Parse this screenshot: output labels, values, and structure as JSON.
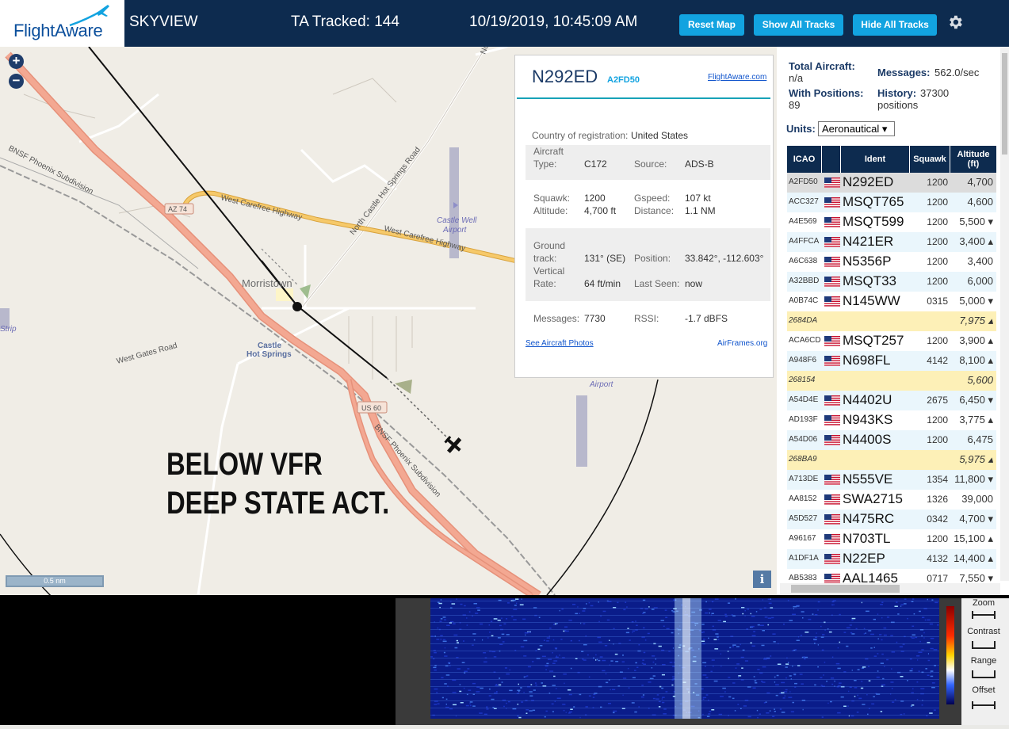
{
  "header": {
    "logo_text": "FlightAware",
    "app_title": "SKYVIEW",
    "tracked": "TA Tracked: 144",
    "datetime": "10/19/2019, 10:45:09 AM",
    "buttons": {
      "reset": "Reset Map",
      "show": "Show All Tracks",
      "hide": "Hide All Tracks"
    },
    "gear_icon": "gear-icon"
  },
  "map": {
    "zoom_in": "+",
    "zoom_out": "−",
    "labels": {
      "bnsf1": "BNSF Phoenix Subdivision",
      "bnsf2": "BNSF Phoenix Subdivision",
      "az74": "AZ 74",
      "wch1": "West Carefree Highway",
      "wch2": "West Carefree Highway",
      "ncsh": "North Castle Hot Springs Road",
      "castle_well": "Castle Well",
      "airport1": "Airport",
      "morristown": "Morristown",
      "castle_hot": "Castle",
      "castle_hot2": "Hot Springs",
      "west_gates": "West Gates Road",
      "us60": "US 60",
      "airport2": "Airport",
      "strip": "Strip",
      "nr": "Nor"
    },
    "scale": "0.5 nm",
    "info_button": "i",
    "overlay_line1": "BELOW VFR",
    "overlay_line2": "DEEP STATE ACT."
  },
  "popup": {
    "registration": "N292ED",
    "icao": "A2FD50",
    "flightaware_link": "FlightAware.com",
    "country_label": "Country of registration:",
    "country": "United States",
    "aircraft_type_label": "Aircraft",
    "aircraft_type_label2": "Type:",
    "aircraft_type": "C172",
    "source_label": "Source:",
    "source": "ADS-B",
    "squawk_label": "Squawk:",
    "squawk": "1200",
    "gspeed_label": "Gspeed:",
    "gspeed": "107 kt",
    "altitude_label": "Altitude:",
    "altitude": "4,700 ft",
    "distance_label": "Distance:",
    "distance": "1.1 NM",
    "ground_label": "Ground",
    "track_label": "track:",
    "track": "131° (SE)",
    "position_label": "Position:",
    "position": "33.842°, -112.603°",
    "vertical_label": "Vertical",
    "rate_label": "Rate:",
    "rate": "64 ft/min",
    "last_seen_label": "Last Seen:",
    "last_seen": "now",
    "messages_label": "Messages:",
    "messages": "7730",
    "rssi_label": "RSSI:",
    "rssi": "-1.7 dBFS",
    "photos_link": "See Aircraft Photos",
    "airframes_link": "AirFrames.org"
  },
  "stats": {
    "total_label": "Total Aircraft:",
    "total": "n/a",
    "messages_label": "Messages:",
    "messages": "562.0/sec",
    "with_pos_label": "With Positions:",
    "with_pos": "89",
    "history_label": "History:",
    "history": "37300",
    "history2": "positions",
    "units_label": "Units:",
    "units": "Aeronautical ▾"
  },
  "table": {
    "headers": [
      "ICAO",
      "",
      "Ident",
      "Squawk",
      "Altitude (ft)"
    ],
    "rows": [
      {
        "icao": "A2FD50",
        "flag": true,
        "ident": "N292ED",
        "squawk": "1200",
        "alt": "4,700",
        "hl": "sel"
      },
      {
        "icao": "ACC327",
        "flag": true,
        "ident": "MSQT765",
        "squawk": "1200",
        "alt": "4,600",
        "hl": ""
      },
      {
        "icao": "A4E569",
        "flag": true,
        "ident": "MSQT599",
        "squawk": "1200",
        "alt": "5,500 ▾",
        "hl": ""
      },
      {
        "icao": "A4FFCA",
        "flag": true,
        "ident": "N421ER",
        "squawk": "1200",
        "alt": "3,400 ▴",
        "hl": ""
      },
      {
        "icao": "A6C638",
        "flag": true,
        "ident": "N5356P",
        "squawk": "1200",
        "alt": "3,400",
        "hl": ""
      },
      {
        "icao": "A32BBD",
        "flag": true,
        "ident": "MSQT33",
        "squawk": "1200",
        "alt": "6,000",
        "hl": ""
      },
      {
        "icao": "A0B74C",
        "flag": true,
        "ident": "N145WW",
        "squawk": "0315",
        "alt": "5,000 ▾",
        "hl": ""
      },
      {
        "icao": "2684DA",
        "flag": false,
        "ident": "",
        "squawk": "",
        "alt": "7,975 ▴",
        "hl": "mlat"
      },
      {
        "icao": "ACA6CD",
        "flag": true,
        "ident": "MSQT257",
        "squawk": "1200",
        "alt": "3,900 ▴",
        "hl": ""
      },
      {
        "icao": "A948F6",
        "flag": true,
        "ident": "N698FL",
        "squawk": "4142",
        "alt": "8,100 ▴",
        "hl": ""
      },
      {
        "icao": "268154",
        "flag": false,
        "ident": "",
        "squawk": "",
        "alt": "5,600",
        "hl": "mlat"
      },
      {
        "icao": "A54D4E",
        "flag": true,
        "ident": "N4402U",
        "squawk": "2675",
        "alt": "6,450 ▾",
        "hl": ""
      },
      {
        "icao": "AD193F",
        "flag": true,
        "ident": "N943KS",
        "squawk": "1200",
        "alt": "3,775 ▴",
        "hl": ""
      },
      {
        "icao": "A54D06",
        "flag": true,
        "ident": "N4400S",
        "squawk": "1200",
        "alt": "6,475",
        "hl": ""
      },
      {
        "icao": "268BA9",
        "flag": false,
        "ident": "",
        "squawk": "",
        "alt": "5,975 ▴",
        "hl": "mlat"
      },
      {
        "icao": "A713DE",
        "flag": true,
        "ident": "N555VE",
        "squawk": "1354",
        "alt": "11,800 ▾",
        "hl": ""
      },
      {
        "icao": "AA8152",
        "flag": true,
        "ident": "SWA2715",
        "squawk": "1326",
        "alt": "39,000",
        "hl": ""
      },
      {
        "icao": "A5D527",
        "flag": true,
        "ident": "N475RC",
        "squawk": "0342",
        "alt": "4,700 ▾",
        "hl": ""
      },
      {
        "icao": "A96167",
        "flag": true,
        "ident": "N703TL",
        "squawk": "1200",
        "alt": "15,100 ▴",
        "hl": ""
      },
      {
        "icao": "A1DF1A",
        "flag": true,
        "ident": "N22EP",
        "squawk": "4132",
        "alt": "14,400 ▴",
        "hl": ""
      },
      {
        "icao": "AB5383",
        "flag": true,
        "ident": "AAL1465",
        "squawk": "0717",
        "alt": "7,550 ▾",
        "hl": ""
      }
    ]
  },
  "waterfall": {
    "controls": [
      "Zoom",
      "Contrast",
      "Range",
      "Offset"
    ]
  },
  "colors": {
    "header": "#0d2b4f",
    "button": "#12a3e0",
    "mlat_row": "#fdf0b7",
    "selected_row": "#dcdcdc",
    "alt_row": "#eaf6fc"
  }
}
